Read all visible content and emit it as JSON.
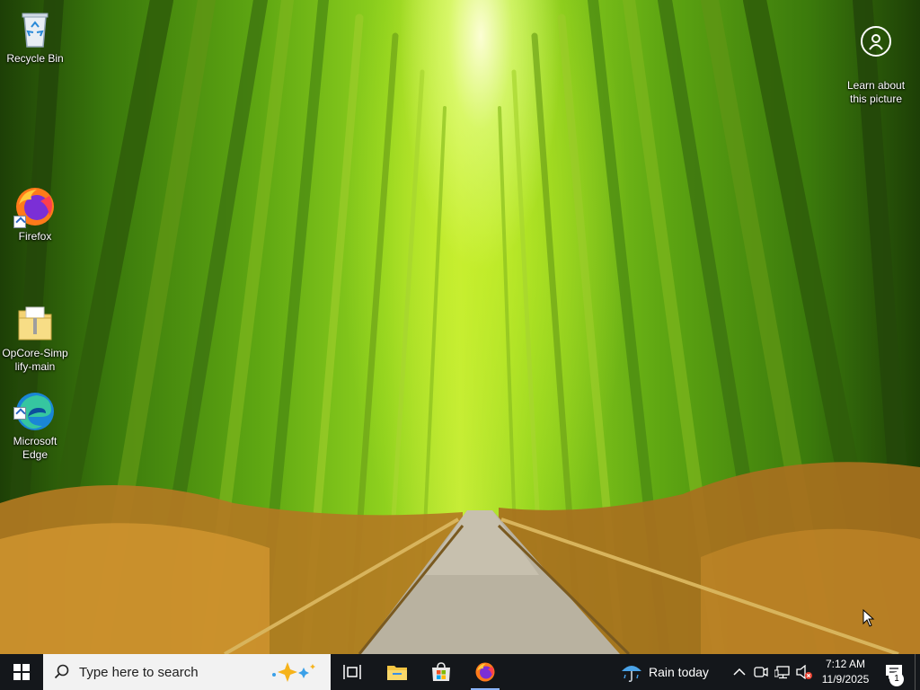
{
  "desktop": {
    "icons": [
      {
        "name": "recycle-bin",
        "label": "Recycle Bin"
      },
      {
        "name": "firefox",
        "label": "Firefox"
      },
      {
        "name": "opcore-folder",
        "label": "OpCore-Simp\nlify-main"
      },
      {
        "name": "edge",
        "label": "Microsoft\nEdge"
      }
    ],
    "spotlight": {
      "label": "Learn about\nthis picture",
      "icon": "camera-pin-icon"
    }
  },
  "taskbar": {
    "search_placeholder": "Type here to search",
    "pinned": [
      "task-view-icon",
      "file-explorer-icon",
      "microsoft-store-icon",
      "firefox-icon"
    ],
    "weather": {
      "label": "Rain today",
      "icon": "umbrella-rain-icon"
    },
    "tray": [
      "chevron-up-icon",
      "meet-now-icon",
      "network-icon",
      "volume-muted-icon"
    ],
    "clock": {
      "time": "7:12 AM",
      "date": "11/9/2025"
    },
    "notifications": {
      "count": "1"
    }
  },
  "colors": {
    "taskbar": "#14171b",
    "accent": "#0078d4",
    "search_bg": "#f2f2f2"
  }
}
